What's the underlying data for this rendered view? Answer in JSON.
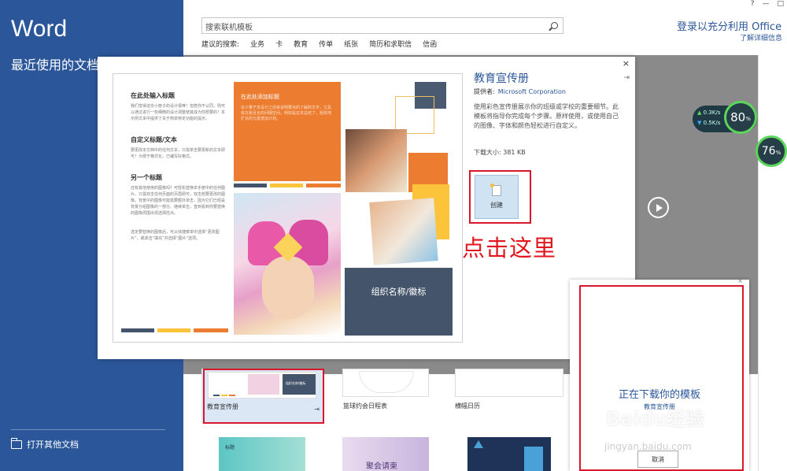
{
  "app": {
    "title": "Word",
    "recent_label": "最近使用的文档",
    "open_other": "打开其他文档"
  },
  "search": {
    "placeholder": "搜索联机模板",
    "suggested_label": "建议的搜索:",
    "suggestions": [
      "业务",
      "卡",
      "教育",
      "传单",
      "纸张",
      "简历和求职信",
      "信函"
    ]
  },
  "account": {
    "signin": "登录以充分利用 Office",
    "learn_more": "了解详细信息"
  },
  "window_controls": [
    "?",
    "—",
    "□"
  ],
  "speed": {
    "up": "0.3K/s",
    "down": "0.5K/s",
    "ring1": "80",
    "ring2": "76",
    "pct": "%"
  },
  "dialog": {
    "template_name": "教育宣传册",
    "provider_label": "提供者:",
    "provider": "Microsoft Corporation",
    "description": "使用彩色宣传册展示你的班级或学校的重要细节。此模板将指导你完成每个步骤。原样使用，或使用自己的图像、字体和颜色轻松进行自定义。",
    "size": "下载大小: 381 KB",
    "create_label": "创建",
    "close": "×",
    "pin": "⇥"
  },
  "brochure": {
    "h1": "在此处输入标题",
    "b1": "我们觉得这份小册子的设计很棒！但若你不认同，则可以通过进行一些细微的设计调整使其成为你想要的！本示例文本中提供了关于简单特定功能的提示。",
    "h2": "自定义标题/文本",
    "b2": "要更改本文档中的任何文本，只需单击要更新的文本即可！为便于格式化，已编写好格式。",
    "h3": "另一个标题",
    "b3": "还有其他使用的图像吗？可轻松替换本手册中的任何图片。只需双击任何页面的页眉即可，双击想要更改的图像。背景中的图像可能需要额外单击，因为它们已经是背景分组图像的一部分。继续单击，直到看到你要替换的图像周围出现选择控点。",
    "b4": "选定要替换的图像后，可从快捷菜单中选择“更改图片”，或单击“填充”并选择“图片”选项。",
    "orange_title": "在此处添加标题",
    "orange_body": "在少量于本设计之前来说明要点的了解的文字，它具有充裕且长的间隔空间，例如是这本总结了，轻松地扩充的元素增加计划。",
    "org": "组织名称/徽标"
  },
  "annotation": {
    "click_here": "点击这里"
  },
  "templates": {
    "edu": "教育宣传册",
    "basketball": "篮球约会日程表",
    "banner": "横幅日历",
    "edu_thumb_text": "组织名称/徽标",
    "teal_thumb_text": "标题",
    "purple_thumb_text": "聚会请柬",
    "pin": "⇥"
  },
  "download": {
    "status": "正在下载你的模板",
    "sub": "教育宣传册",
    "cancel": "取消",
    "close": "×"
  },
  "watermark": {
    "brand": "Baidu经验",
    "url": "jingyan.baidu.com"
  },
  "colors": {
    "word_blue": "#2b579a",
    "orange": "#ec7c30",
    "slate": "#44546a",
    "yellow": "#fbc43a",
    "annotation_red": "#d9172a"
  }
}
